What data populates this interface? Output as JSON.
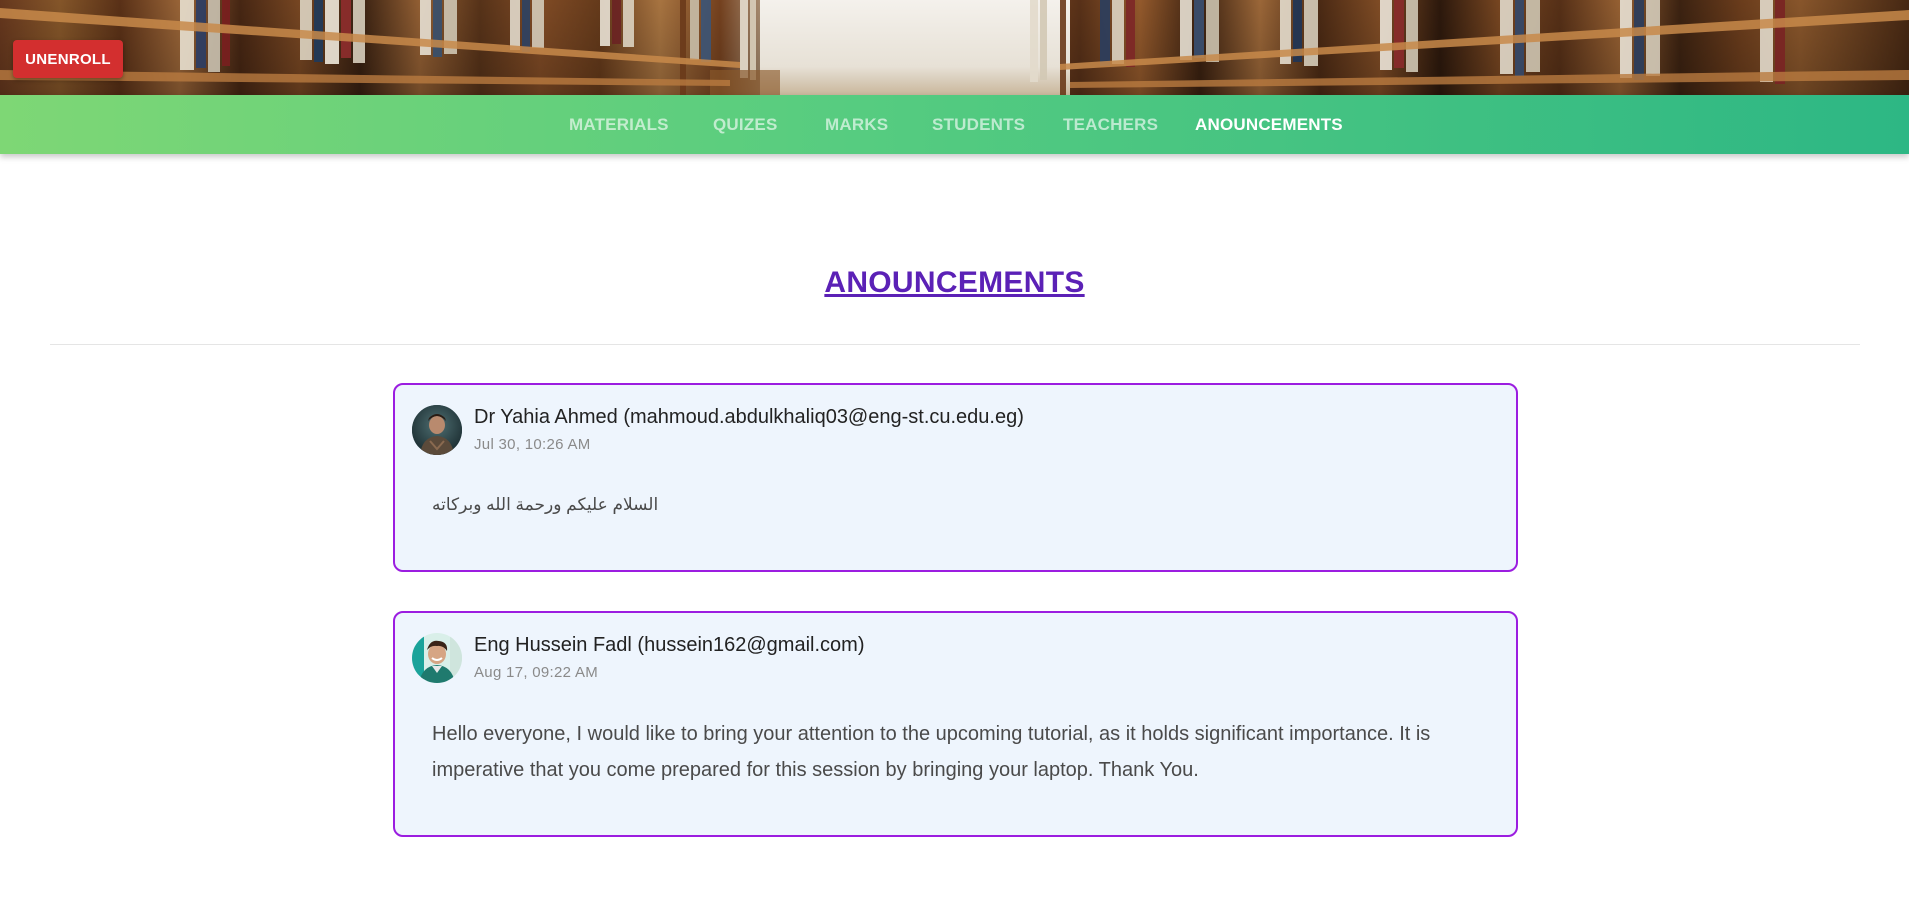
{
  "header": {
    "unenroll_label": "UNENROLL"
  },
  "nav": {
    "items": [
      {
        "label": "MATERIALS",
        "active": false
      },
      {
        "label": "QUIZES",
        "active": false
      },
      {
        "label": "MARKS",
        "active": false
      },
      {
        "label": "STUDENTS",
        "active": false
      },
      {
        "label": "TEACHERS",
        "active": false
      },
      {
        "label": "ANOUNCEMENTS",
        "active": true
      }
    ]
  },
  "page": {
    "title": "ANOUNCEMENTS"
  },
  "announcements": [
    {
      "author": "Dr Yahia Ahmed (mahmoud.abdulkhaliq03@eng-st.cu.edu.eg)",
      "timestamp": "Jul 30, 10:26 AM",
      "message": "السلام عليكم ورحمة الله وبركاته",
      "avatar": "avatar-photo-man-dark"
    },
    {
      "author": "Eng Hussein Fadl (hussein162@gmail.com)",
      "timestamp": "Aug 17, 09:22 AM",
      "message": "Hello everyone, I would like to bring your attention to the upcoming tutorial, as it holds significant importance. It is imperative that you come prepared for this session by bringing your laptop. Thank You.",
      "avatar": "avatar-photo-man-smiling"
    }
  ],
  "colors": {
    "accent_purple": "#5b21b6",
    "card_border": "#9b1de0",
    "card_bg": "#eef5fd",
    "nav_gradient_start": "#7ed775",
    "nav_gradient_end": "#2db784",
    "unenroll_red": "#d32f2f"
  }
}
